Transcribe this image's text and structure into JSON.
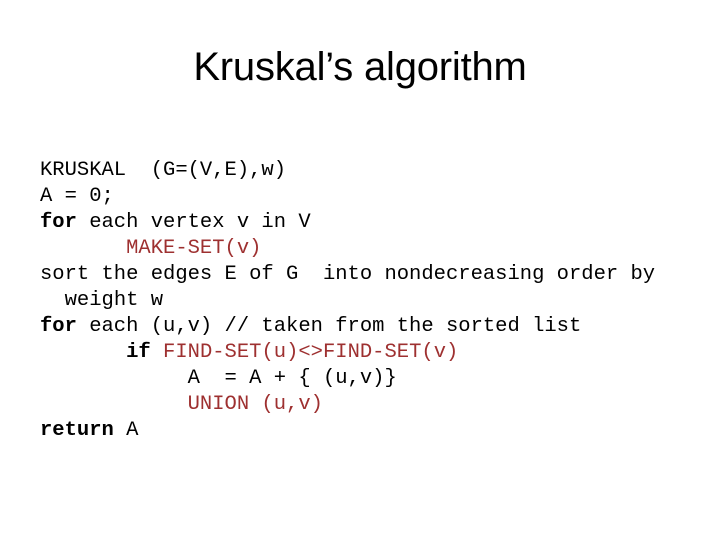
{
  "slide": {
    "title": "Kruskal’s algorithm",
    "background_color": "#ffffff",
    "text_color": "#000000",
    "accent_color": "#9e3030"
  },
  "code": {
    "lines": [
      {
        "id": "line-1",
        "indent": "",
        "segments": [
          {
            "style": "plain",
            "text": "KRUSKAL  (G=(V,E),w)"
          }
        ]
      },
      {
        "id": "line-2",
        "indent": "",
        "segments": [
          {
            "style": "plain",
            "text": "A = 0;"
          }
        ]
      },
      {
        "id": "line-3",
        "indent": "",
        "segments": [
          {
            "style": "keyword",
            "text": "for"
          },
          {
            "style": "plain",
            "text": " each vertex v in V"
          }
        ]
      },
      {
        "id": "line-4",
        "indent": "       ",
        "segments": [
          {
            "style": "function",
            "text": "MAKE-SET(v)"
          }
        ]
      },
      {
        "id": "line-5",
        "indent": "",
        "segments": [
          {
            "style": "plain",
            "text": "sort the edges E of G  into nondecreasing order by"
          }
        ]
      },
      {
        "id": "line-6",
        "indent": "  ",
        "segments": [
          {
            "style": "plain",
            "text": "weight w"
          }
        ]
      },
      {
        "id": "line-7",
        "indent": "",
        "segments": [
          {
            "style": "keyword",
            "text": "for"
          },
          {
            "style": "plain",
            "text": " each (u,v) // taken from the sorted list"
          }
        ]
      },
      {
        "id": "line-8",
        "indent": "       ",
        "segments": [
          {
            "style": "keyword",
            "text": "if"
          },
          {
            "style": "plain",
            "text": " "
          },
          {
            "style": "function",
            "text": "FIND-SET(u)<>FIND-SET(v)"
          }
        ]
      },
      {
        "id": "line-9",
        "indent": "            ",
        "segments": [
          {
            "style": "plain",
            "text": "A  = A + { (u,v)}"
          }
        ]
      },
      {
        "id": "line-10",
        "indent": "            ",
        "segments": [
          {
            "style": "function",
            "text": "UNION (u,v)"
          }
        ]
      },
      {
        "id": "line-11",
        "indent": "",
        "segments": [
          {
            "style": "keyword",
            "text": "return"
          },
          {
            "style": "plain",
            "text": " A"
          }
        ]
      }
    ]
  }
}
